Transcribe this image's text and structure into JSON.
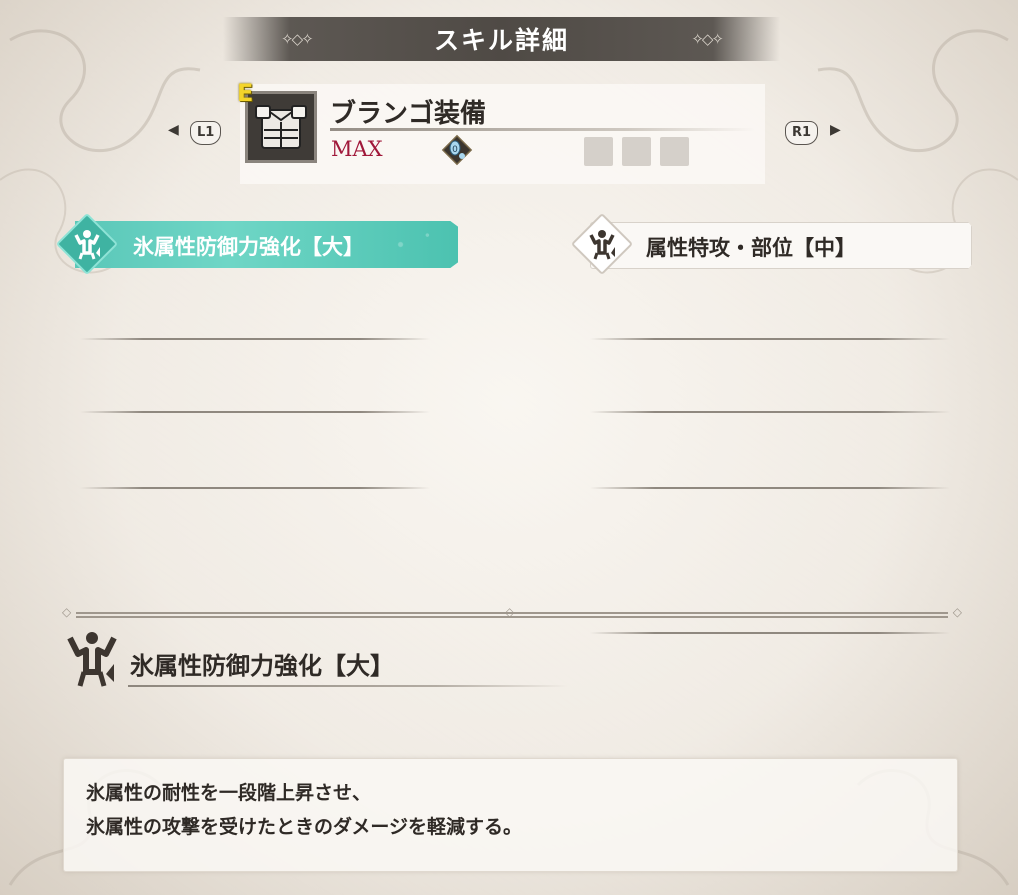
{
  "header": {
    "title": "スキル詳細"
  },
  "equipment": {
    "rank": "E",
    "name": "ブランゴ装備",
    "level": "MAX",
    "decoration_slot_value": "0",
    "icon": "armor-chest-icon",
    "empty_slots": 3
  },
  "nav": {
    "prev_button": "L1",
    "next_button": "R1"
  },
  "skills": [
    {
      "label": "氷属性防御力強化【大】",
      "selected": true,
      "icon": "muscle-skill-icon"
    },
    {
      "label": "属性特攻・部位【中】",
      "selected": false,
      "icon": "muscle-skill-icon"
    }
  ],
  "detail": {
    "name": "氷属性防御力強化【大】",
    "icon": "muscle-skill-icon",
    "description_lines": [
      "氷属性の耐性を一段階上昇させ、",
      "氷属性の攻撃を受けたときのダメージを軽減する。"
    ]
  },
  "colors": {
    "selected_tab": "#5ac7b8",
    "level_text": "#a0183a",
    "rank_letter": "#f4d52a",
    "banner": "#4f4a45"
  }
}
